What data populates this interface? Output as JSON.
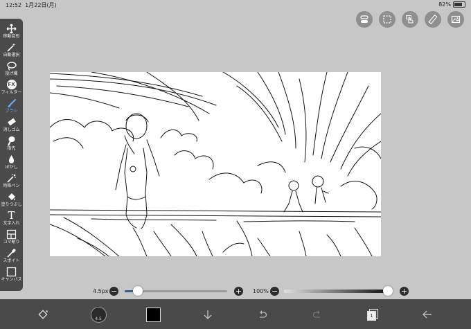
{
  "status_bar": {
    "time": "12:52",
    "date": "1月22日(月)",
    "battery": "82%",
    "battery_level": 0.82
  },
  "top_actions": [
    {
      "name": "toggle-icon"
    },
    {
      "name": "selection-icon"
    },
    {
      "name": "hand-touch-icon"
    },
    {
      "name": "ruler-icon"
    },
    {
      "name": "image-icon"
    }
  ],
  "tools": [
    {
      "label": "移動変形",
      "icon": "move-icon"
    },
    {
      "label": "自動選択",
      "icon": "magic-wand-icon"
    },
    {
      "label": "投げ縄",
      "icon": "lasso-icon"
    },
    {
      "label": "フィルター",
      "icon": "fx-icon",
      "glyph": "FX"
    },
    {
      "label": "ブラシ",
      "icon": "brush-icon",
      "active": true
    },
    {
      "label": "消しゴム",
      "icon": "eraser-icon"
    },
    {
      "label": "指先",
      "icon": "finger-icon"
    },
    {
      "label": "ぼかし",
      "icon": "blur-drop-icon"
    },
    {
      "label": "特殊ペン",
      "icon": "special-pen-icon"
    },
    {
      "label": "塗りつぶし",
      "icon": "fill-bucket-icon"
    },
    {
      "label": "文字入れ",
      "icon": "text-icon",
      "glyph": "T"
    },
    {
      "label": "コマ割り",
      "icon": "frame-divider-icon"
    },
    {
      "label": "スポイト",
      "icon": "eyedropper-icon"
    },
    {
      "label": "キャンバス",
      "icon": "canvas-icon"
    }
  ],
  "brush_size": {
    "label": "4.5px",
    "level": 0.08,
    "minus": "−",
    "plus": "+"
  },
  "opacity": {
    "label": "100%",
    "level": 1.0,
    "minus": "−",
    "plus": "+"
  },
  "bottom": {
    "color_hex": "#000000",
    "accent": "#6aa8ff",
    "layer_count": "1",
    "brush_preview_label": "4.5"
  }
}
